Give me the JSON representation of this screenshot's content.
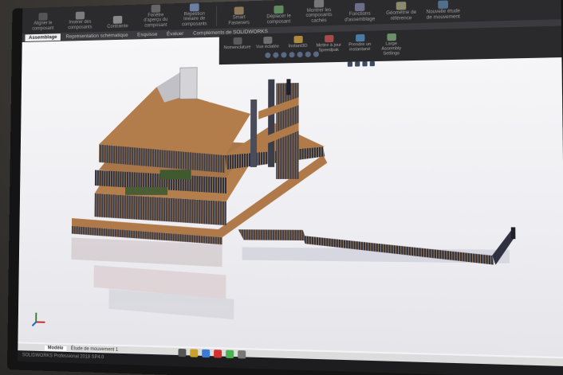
{
  "toolbar": {
    "items": [
      {
        "label": "Aligner le composant",
        "icon": "align-icon"
      },
      {
        "label": "Insérer des composants",
        "icon": "insert-components-icon"
      },
      {
        "label": "Contrainte",
        "icon": "mate-icon"
      },
      {
        "label": "Fenêtre d'aperçu du composant",
        "icon": "preview-window-icon"
      },
      {
        "label": "Répétition linéaire de composants",
        "icon": "linear-pattern-icon"
      },
      {
        "label": "Smart Fasteners",
        "icon": "fasteners-icon"
      },
      {
        "label": "Déplacer le composant",
        "icon": "move-component-icon"
      },
      {
        "label": "Montrer les composants cachés",
        "icon": "show-hidden-icon"
      },
      {
        "label": "Fonctions d'assemblage",
        "icon": "assembly-features-icon"
      },
      {
        "label": "Géométrie de référence",
        "icon": "reference-geometry-icon"
      },
      {
        "label": "Nouvelle étude de mouvement",
        "icon": "motion-study-icon"
      }
    ]
  },
  "ribbon": {
    "items": [
      {
        "label": "Nomenclature",
        "icon": "bom-icon"
      },
      {
        "label": "Vue éclatée",
        "icon": "exploded-view-icon"
      },
      {
        "label": "Instant3D",
        "icon": "instant3d-icon"
      },
      {
        "label": "Mettre à jour Speedpak",
        "icon": "speedpak-icon"
      },
      {
        "label": "Prendre un instantané",
        "icon": "snapshot-icon"
      },
      {
        "label": "Large Assembly Settings",
        "icon": "large-assembly-icon"
      }
    ]
  },
  "tabs": [
    "Assemblage",
    "Représentation schématique",
    "Esquisse",
    "Évaluer",
    "Compléments de SOLIDWORKS"
  ],
  "bottom_tabs": [
    "Modèle",
    "Étude de mouvement 1"
  ],
  "status": {
    "text": "SOLIDWORKS Professional 2018 SP4.0"
  },
  "colors": {
    "wood": "#b0794a",
    "steel": "#3b3d4a",
    "accent": "#c62828"
  }
}
